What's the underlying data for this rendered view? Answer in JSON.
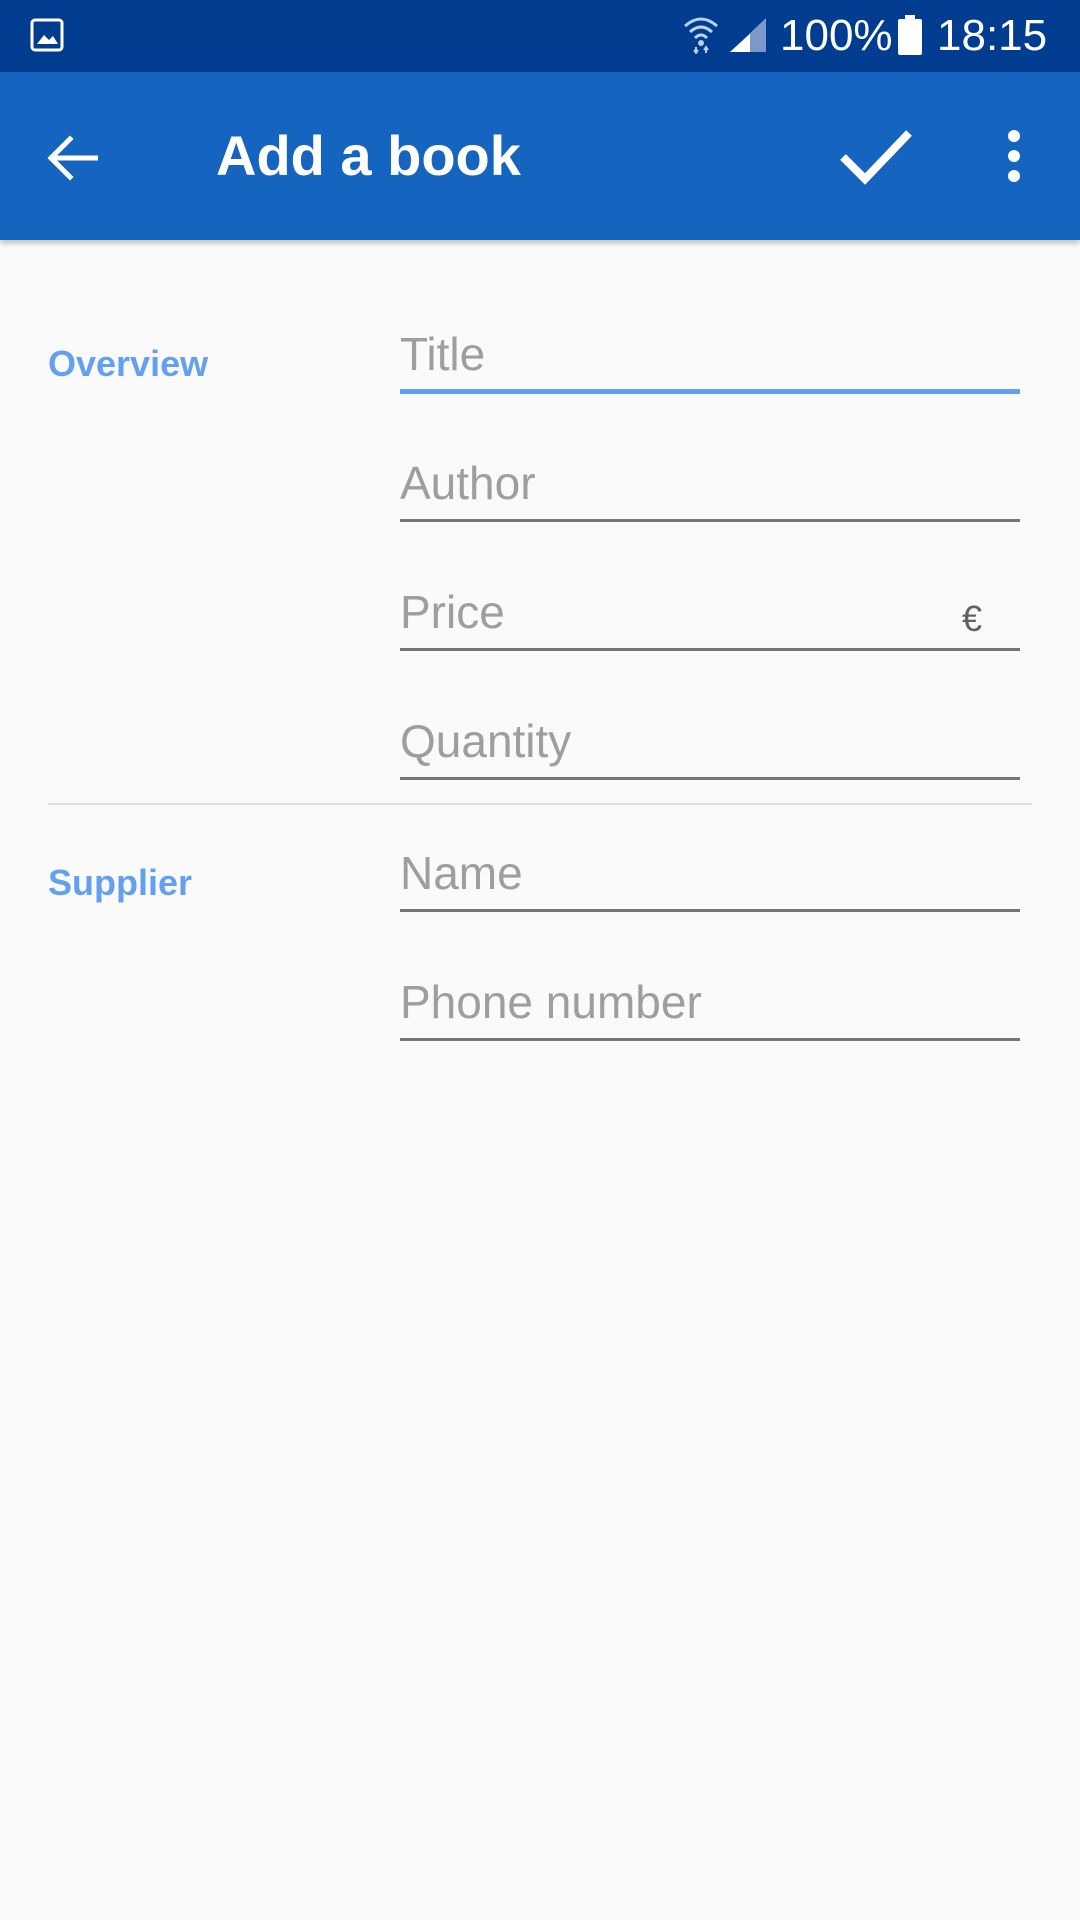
{
  "status_bar": {
    "battery_percent": "100%",
    "time": "18:15",
    "icons": [
      "gallery-icon",
      "wifi-icon",
      "cell-signal-icon",
      "battery-icon"
    ]
  },
  "app_bar": {
    "title": "Add a book",
    "icons": [
      "back-arrow-icon",
      "checkmark-icon",
      "more-vert-icon"
    ],
    "background_color": "#1565c0"
  },
  "overview": {
    "label": "Overview",
    "title_placeholder": "Title",
    "author_placeholder": "Author",
    "price_placeholder": "Price",
    "price_suffix": "€",
    "quantity_placeholder": "Quantity"
  },
  "supplier": {
    "label": "Supplier",
    "name_placeholder": "Name",
    "phone_placeholder": "Phone number"
  },
  "colors": {
    "accent": "#64a0f0",
    "status_bar": "#003c8f"
  }
}
